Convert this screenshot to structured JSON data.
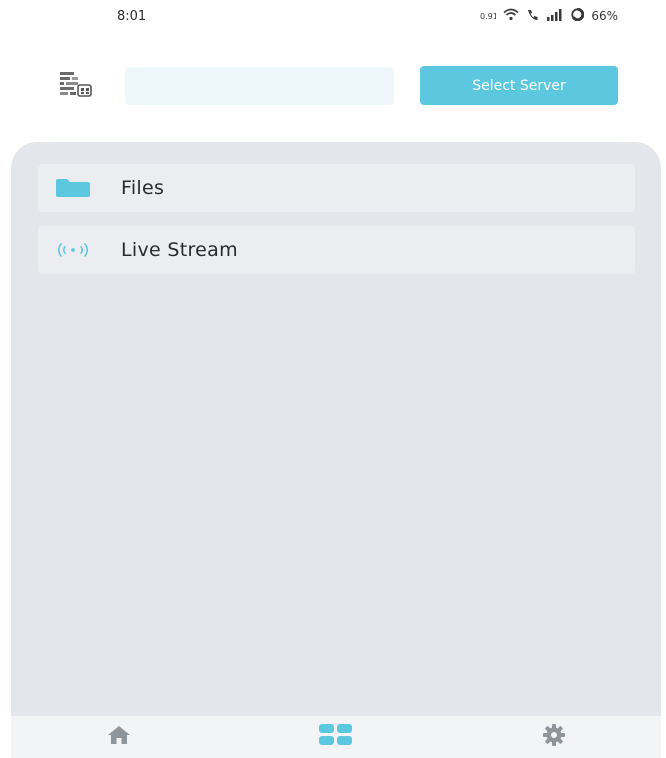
{
  "status_bar": {
    "time": "8:01",
    "battery": "66%",
    "icons": [
      "data-icon",
      "wifi-icon",
      "signal-icon",
      "battery-icon"
    ]
  },
  "top_bar": {
    "server_input_value": "",
    "server_input_placeholder": "",
    "select_server_label": "Select Server",
    "qr_icon": "qr-code-icon"
  },
  "menu": {
    "items": [
      {
        "label": "Files",
        "icon": "folder-icon"
      },
      {
        "label": "Live Stream",
        "icon": "live-stream-icon"
      }
    ]
  },
  "bottom_nav": {
    "items": [
      {
        "icon": "home-icon",
        "active": false
      },
      {
        "icon": "dashboard-icon",
        "active": true
      },
      {
        "icon": "settings-icon",
        "active": false
      }
    ]
  },
  "colors": {
    "accent": "#5cc8df",
    "panel": "#e3e6ea",
    "card": "#ecedf0",
    "nav_inactive": "#8e959b"
  }
}
